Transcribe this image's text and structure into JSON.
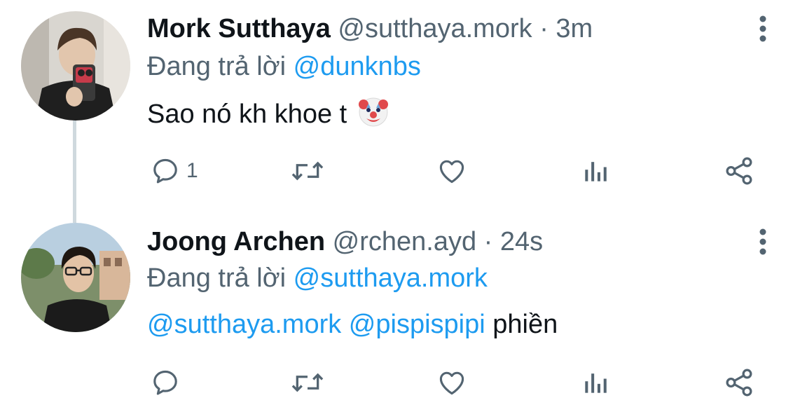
{
  "tweets": [
    {
      "name": "Mork Sutthaya",
      "handle": "@sutthaya.mork",
      "separator": "·",
      "time": "3m",
      "replying_prefix": "Đang trả lời",
      "replying_to": "@dunknbs",
      "body_text": "Sao nó kh khoe t",
      "body_emoji": "clown-face-icon",
      "reply_count": "1"
    },
    {
      "name": "Joong Archen",
      "handle": "@rchen.ayd",
      "separator": "·",
      "time": "24s",
      "replying_prefix": "Đang trả lời",
      "replying_to": "@sutthaya.mork",
      "mention_1": "@sutthaya.mork",
      "mention_2": "@pispispipi",
      "body_text": "phiền",
      "reply_count": ""
    }
  ],
  "colors": {
    "link": "#1d9bf0",
    "muted": "#536471",
    "text": "#0f1419",
    "thread_line": "#cfd9de"
  }
}
